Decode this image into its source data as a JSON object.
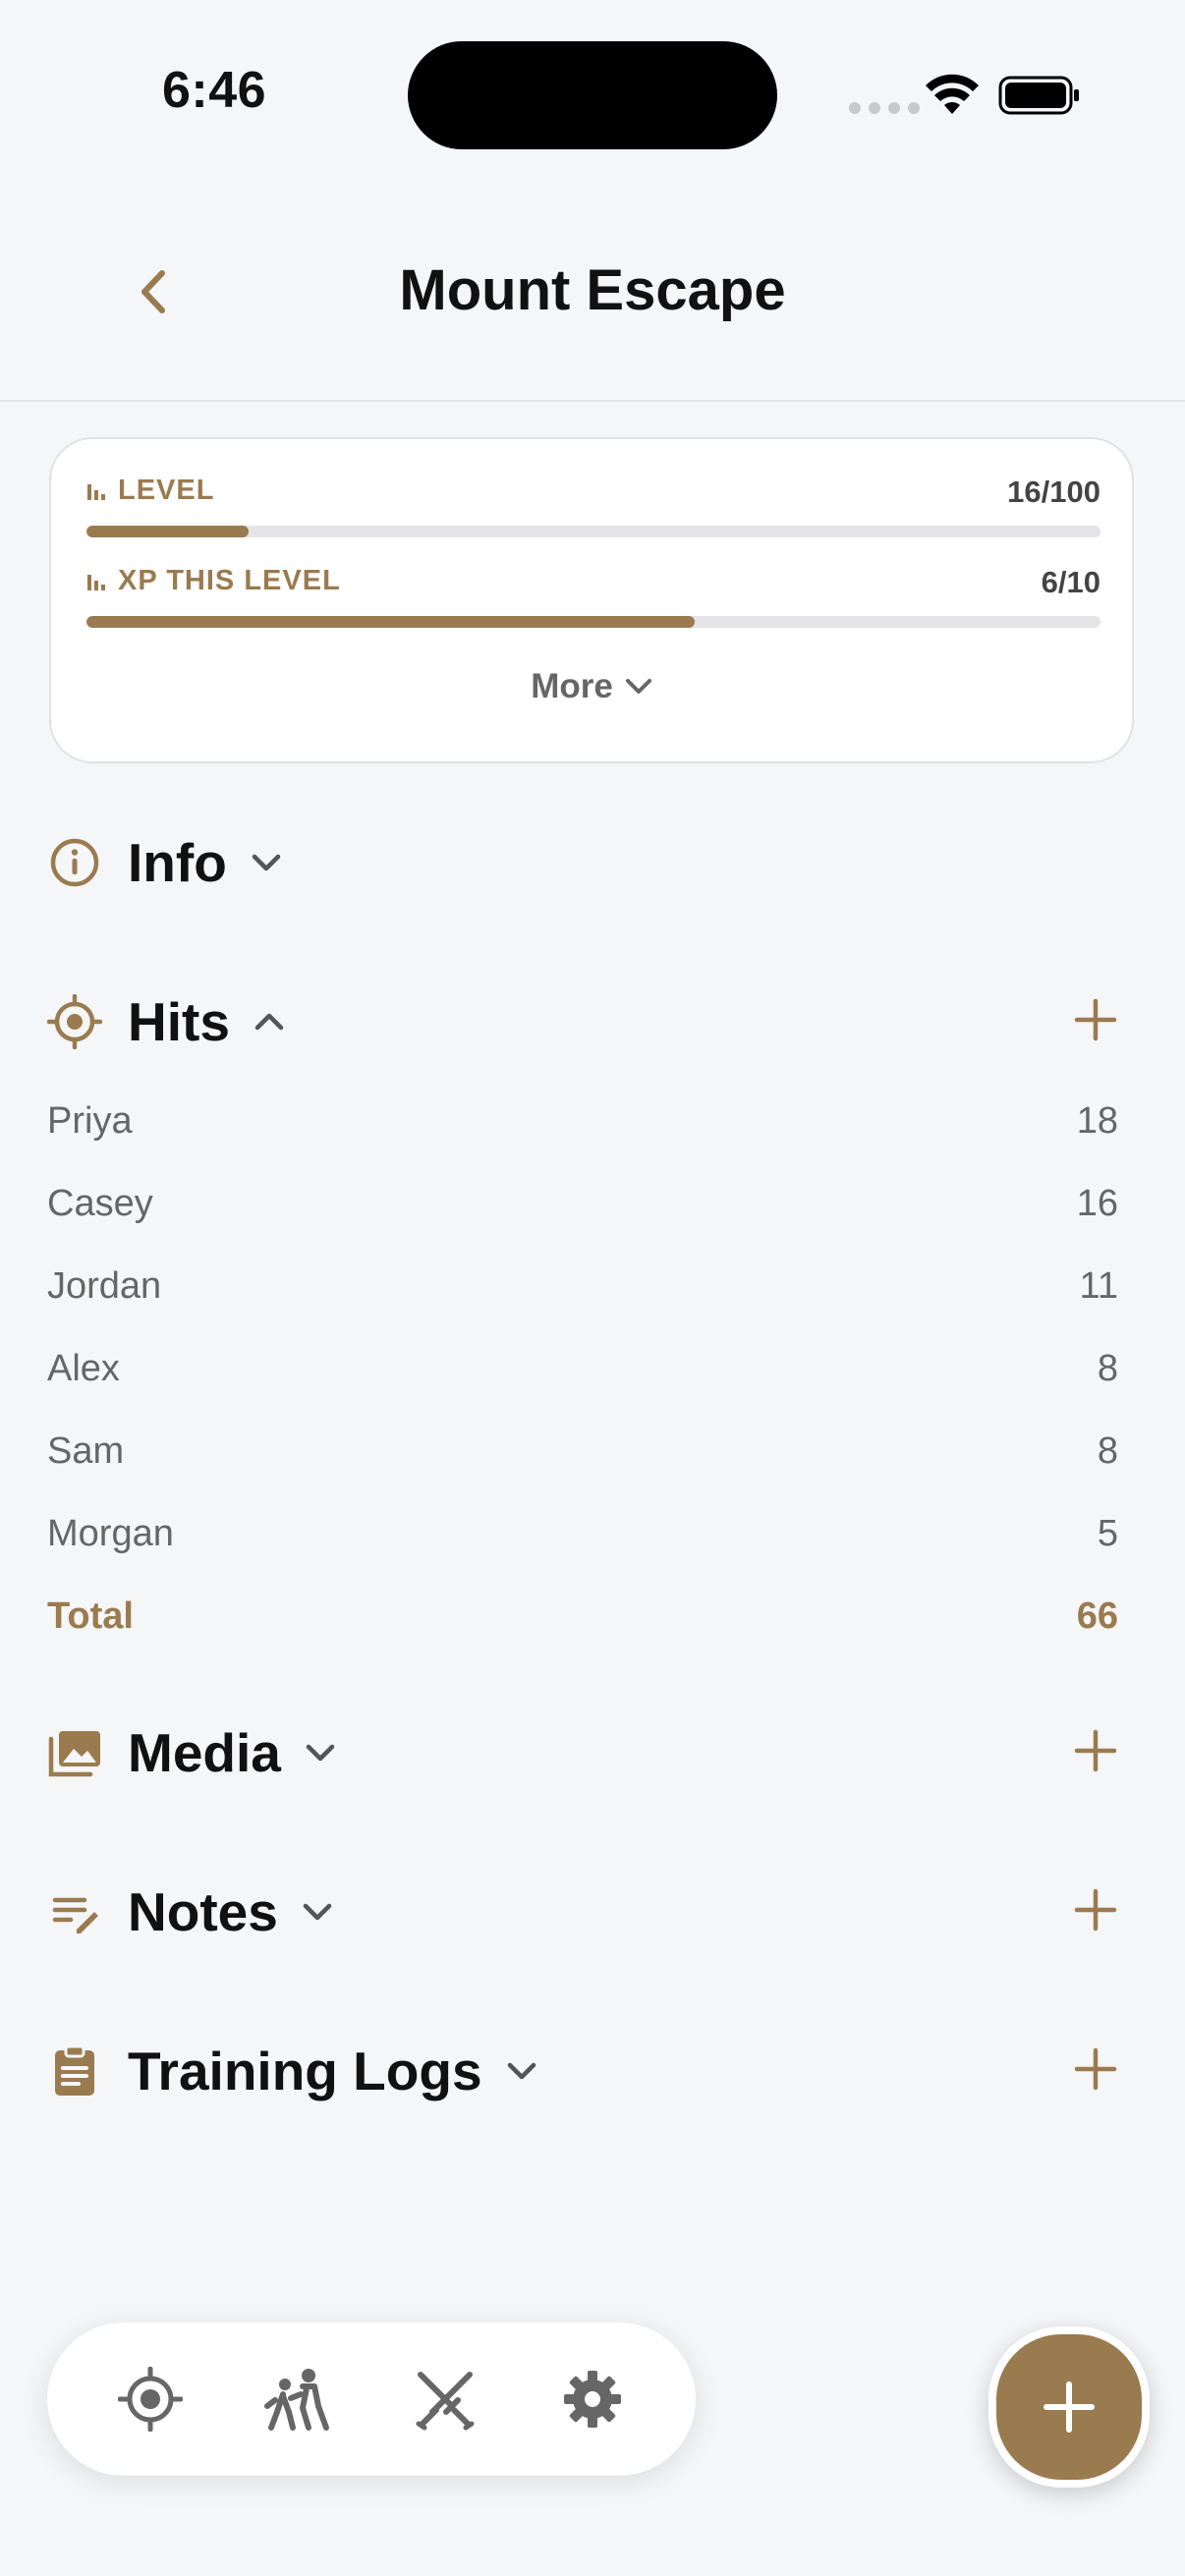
{
  "status_bar": {
    "time": "6:46"
  },
  "header": {
    "title": "Mount Escape",
    "back_icon": "chevron-left-icon"
  },
  "stats": {
    "level": {
      "label": "LEVEL",
      "value_text": "16/100",
      "progress": 0.16
    },
    "xp": {
      "label": "XP THIS LEVEL",
      "value_text": "6/10",
      "progress": 0.6
    },
    "more_label": "More"
  },
  "sections": {
    "info": {
      "title": "Info",
      "icon": "info-circle-icon",
      "expanded": false
    },
    "hits": {
      "title": "Hits",
      "icon": "target-icon",
      "expanded": true,
      "rows": [
        {
          "name": "Priya",
          "count": "18"
        },
        {
          "name": "Casey",
          "count": "16"
        },
        {
          "name": "Jordan",
          "count": "11"
        },
        {
          "name": "Alex",
          "count": "8"
        },
        {
          "name": "Sam",
          "count": "8"
        },
        {
          "name": "Morgan",
          "count": "5"
        }
      ],
      "total": {
        "name": "Total",
        "count": "66"
      }
    },
    "media": {
      "title": "Media",
      "icon": "photo-library-icon",
      "expanded": false
    },
    "notes": {
      "title": "Notes",
      "icon": "edit-note-icon",
      "expanded": false
    },
    "training_logs": {
      "title": "Training Logs",
      "icon": "clipboard-icon",
      "expanded": false
    }
  },
  "tab_bar": {
    "tabs": [
      "target-icon",
      "sparring-icon",
      "crossed-swords-icon",
      "gear-icon"
    ]
  },
  "colors": {
    "accent": "#9a7b4f",
    "background": "#f5f6f8",
    "card": "#ffffff",
    "text_secondary": "#666666"
  }
}
